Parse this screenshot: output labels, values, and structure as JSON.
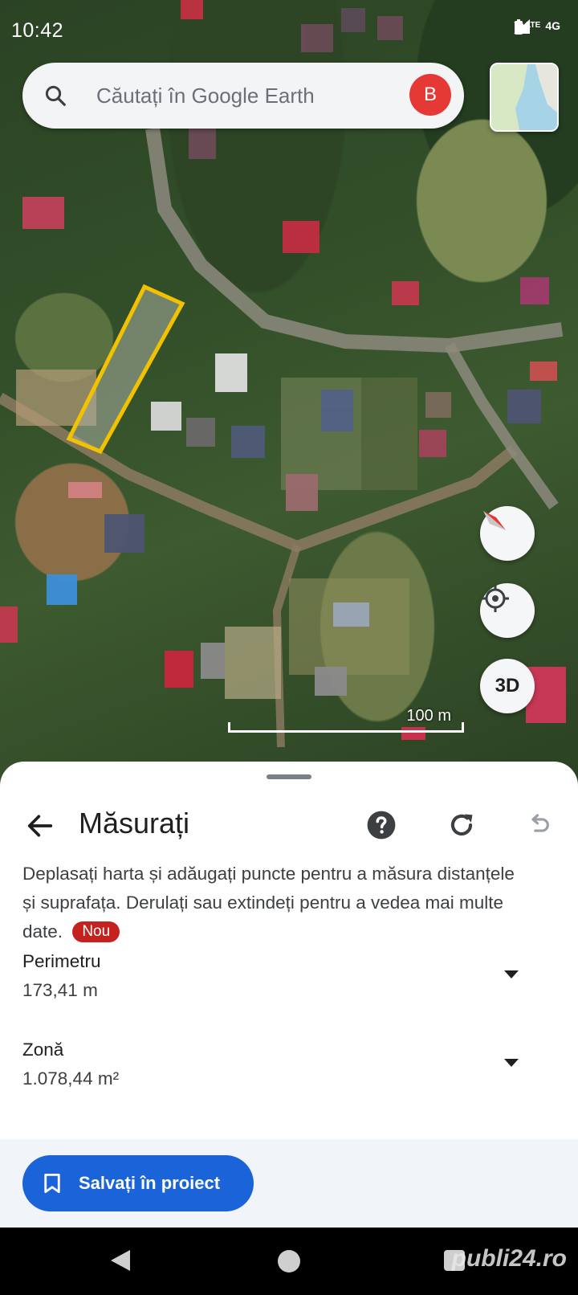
{
  "status": {
    "time": "10:42",
    "network": "4G",
    "volte": "Vo LTE"
  },
  "search": {
    "placeholder": "Căutați în Google Earth",
    "avatar_letter": "B"
  },
  "map": {
    "scale_label": "100 m",
    "button_3d": "3D"
  },
  "sheet": {
    "title": "Măsurați",
    "description": "Deplasați harta și adăugați puncte pentru a măsura distanțele și suprafața. Derulați sau extindeți pentru a vedea mai multe date.",
    "badge": "Nou",
    "rows": [
      {
        "label": "Perimetru",
        "value": "173,41 m"
      },
      {
        "label": "Zonă",
        "value": "1.078,44 m²"
      }
    ],
    "save_button": "Salvați în proiect"
  },
  "watermark": "publi24.ro",
  "colors": {
    "primary": "#1a63d9",
    "badge": "#c5221f",
    "avatar": "#e53935",
    "polygon": "#f2c200"
  }
}
